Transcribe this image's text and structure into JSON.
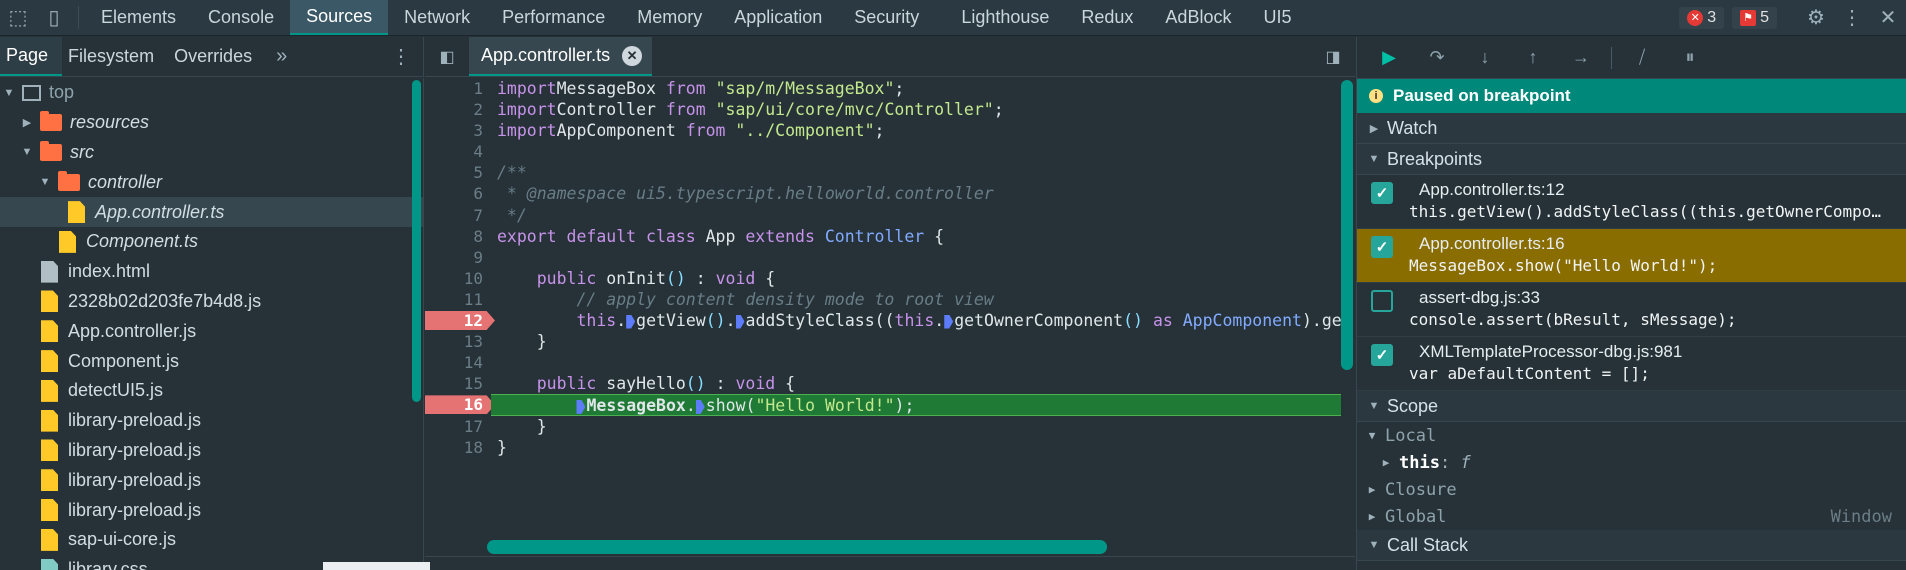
{
  "main_tabs": [
    "Elements",
    "Console",
    "Sources",
    "Network",
    "Performance",
    "Memory",
    "Application",
    "Security",
    "Lighthouse",
    "Redux",
    "AdBlock",
    "UI5"
  ],
  "active_main_tab": "Sources",
  "error_count": "3",
  "issue_count": "5",
  "navigator": {
    "tabs": [
      "Page",
      "Filesystem",
      "Overrides"
    ],
    "more": "»",
    "tree": [
      {
        "label": "top",
        "kind": "frame",
        "indent": 0,
        "arrow": "open"
      },
      {
        "label": "resources",
        "kind": "folder",
        "indent": 1,
        "arrow": "closed",
        "italic": true
      },
      {
        "label": "src",
        "kind": "folder",
        "indent": 1,
        "arrow": "open",
        "italic": true
      },
      {
        "label": "controller",
        "kind": "folder",
        "indent": 2,
        "arrow": "open",
        "italic": true
      },
      {
        "label": "App.controller.ts",
        "kind": "file",
        "indent": 3,
        "arrow": "none",
        "italic": true,
        "selected": true
      },
      {
        "label": "Component.ts",
        "kind": "file",
        "indent": 2.5,
        "arrow": "none",
        "italic": true
      },
      {
        "label": "index.html",
        "kind": "file-grey",
        "indent": 1.5,
        "arrow": "none"
      },
      {
        "label": "2328b02d203fe7b4d8.js",
        "kind": "file",
        "indent": 1.5,
        "arrow": "none"
      },
      {
        "label": "App.controller.js",
        "kind": "file",
        "indent": 1.5,
        "arrow": "none"
      },
      {
        "label": "Component.js",
        "kind": "file",
        "indent": 1.5,
        "arrow": "none"
      },
      {
        "label": "detectUI5.js",
        "kind": "file",
        "indent": 1.5,
        "arrow": "none"
      },
      {
        "label": "library-preload.js",
        "kind": "file",
        "indent": 1.5,
        "arrow": "none"
      },
      {
        "label": "library-preload.js",
        "kind": "file",
        "indent": 1.5,
        "arrow": "none"
      },
      {
        "label": "library-preload.js",
        "kind": "file",
        "indent": 1.5,
        "arrow": "none"
      },
      {
        "label": "library-preload.js",
        "kind": "file",
        "indent": 1.5,
        "arrow": "none"
      },
      {
        "label": "sap-ui-core.js",
        "kind": "file",
        "indent": 1.5,
        "arrow": "none"
      },
      {
        "label": "library.css",
        "kind": "file-teal",
        "indent": 1.5,
        "arrow": "none"
      }
    ]
  },
  "editor": {
    "tab_label": "App.controller.ts",
    "close_glyph": "✕",
    "breakpoint_lines": [
      12,
      16
    ],
    "exec_line": 16,
    "lines": [
      [
        [
          "kw",
          "import"
        ],
        [
          "",
          "MessageBox "
        ],
        [
          "kw",
          "from"
        ],
        [
          "",
          ""
        ],
        [
          "str",
          " \"sap/m/MessageBox\""
        ],
        [
          "",
          ";"
        ]
      ],
      [
        [
          "kw",
          "import"
        ],
        [
          "",
          "Controller "
        ],
        [
          "kw",
          "from"
        ],
        [
          "str",
          " \"sap/ui/core/mvc/Controller\""
        ],
        [
          "",
          ";"
        ]
      ],
      [
        [
          "kw",
          "import"
        ],
        [
          "",
          "AppComponent "
        ],
        [
          "kw",
          "from"
        ],
        [
          "str",
          " \"../Component\""
        ],
        [
          "",
          ";"
        ]
      ],
      [
        [
          "",
          ""
        ]
      ],
      [
        [
          "cm",
          "/**"
        ]
      ],
      [
        [
          "cm",
          " * @namespace ui5.typescript.helloworld.controller"
        ]
      ],
      [
        [
          "cm",
          " */"
        ]
      ],
      [
        [
          "kw",
          "export default class "
        ],
        [
          "",
          "App "
        ],
        [
          "kw",
          "extends "
        ],
        [
          "cls",
          "Controller"
        ],
        [
          "",
          " {"
        ]
      ],
      [
        [
          "",
          ""
        ]
      ],
      [
        [
          "",
          "    "
        ],
        [
          "kw",
          "public "
        ],
        [
          "",
          "onInit"
        ],
        [
          "typ",
          "()"
        ],
        [
          "",
          " : "
        ],
        [
          "kw",
          "void"
        ],
        [
          "",
          " {"
        ]
      ],
      [
        [
          "",
          "        "
        ],
        [
          "cm",
          "// apply content density mode to root view"
        ]
      ],
      [
        [
          "",
          "        "
        ],
        [
          "kw",
          "this"
        ],
        [
          "",
          "."
        ],
        [
          "mark",
          ""
        ],
        [
          "",
          "getView"
        ],
        [
          "typ",
          "()"
        ],
        [
          "",
          "."
        ],
        [
          "mark",
          ""
        ],
        [
          "",
          "addStyleClass(("
        ],
        [
          "kw",
          "this"
        ],
        [
          "",
          "."
        ],
        [
          "mark",
          ""
        ],
        [
          "",
          "getOwnerComponent"
        ],
        [
          "typ",
          "()"
        ],
        [
          "",
          " "
        ],
        [
          "kw",
          "as "
        ],
        [
          "cls",
          "AppComponent"
        ],
        [
          "",
          ").getContentDensityClass());"
        ]
      ],
      [
        [
          "",
          "    }"
        ]
      ],
      [
        [
          "",
          ""
        ]
      ],
      [
        [
          "",
          "    "
        ],
        [
          "kw",
          "public "
        ],
        [
          "",
          "sayHello"
        ],
        [
          "typ",
          "()"
        ],
        [
          "",
          " : "
        ],
        [
          "kw",
          "void"
        ],
        [
          "",
          " {"
        ]
      ],
      [
        [
          "",
          "        "
        ],
        [
          "mark",
          ""
        ],
        [
          "boldcls",
          "MessageBox"
        ],
        [
          "",
          "."
        ],
        [
          "mark",
          ""
        ],
        [
          "",
          "show("
        ],
        [
          "str",
          "\"Hello World!\""
        ],
        [
          "",
          ");"
        ]
      ],
      [
        [
          "",
          "    }"
        ]
      ],
      [
        [
          "",
          "}"
        ]
      ]
    ]
  },
  "debugger": {
    "paused_text": "Paused on breakpoint",
    "sections": {
      "watch": "Watch",
      "breakpoints": "Breakpoints",
      "scope": "Scope",
      "call_stack": "Call Stack"
    },
    "breakpoints": [
      {
        "title": "App.controller.ts:12",
        "code": "this.getView().addStyleClass((this.getOwnerComponent() as AppComponent).getContentDensityClass());",
        "checked": true,
        "hit": false
      },
      {
        "title": "App.controller.ts:16",
        "code": "MessageBox.show(\"Hello World!\");",
        "checked": true,
        "hit": true
      },
      {
        "title": "assert-dbg.js:33",
        "code": "console.assert(bResult, sMessage);",
        "checked": false,
        "hit": false
      },
      {
        "title": "XMLTemplateProcessor-dbg.js:981",
        "code": "var aDefaultContent = [];",
        "checked": true,
        "hit": false
      }
    ],
    "scope": {
      "local_label": "Local",
      "this_name": "this",
      "this_value": "f",
      "closure_label": "Closure",
      "global_label": "Global",
      "global_value": "Window"
    }
  }
}
